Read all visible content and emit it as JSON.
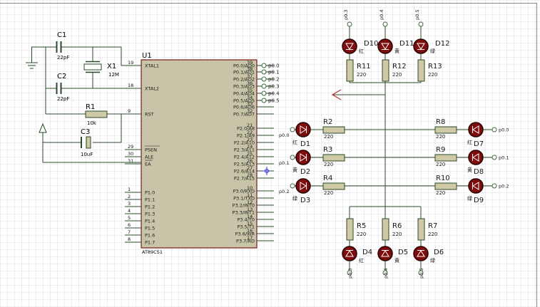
{
  "colors": {
    "background": "#ffffff",
    "grid": "#dedede",
    "wire": "#2a4b2a",
    "chip_fill": "#c7c4a7",
    "chip_border": "#7a1b1b",
    "resistor_fill": "#cfc9a6",
    "led_fill": "#7e0d0d",
    "led_ring": "#2a0000",
    "text": "#1a1a1a",
    "pin_number": "#1a1a1a",
    "ground_marker": "#c23030",
    "crosshair": "#2a36c8",
    "terminal": "#3a6e3a"
  },
  "capacitors": {
    "c1": {
      "name": "C1",
      "value": "22pF"
    },
    "c2": {
      "name": "C2",
      "value": "22pF"
    },
    "c3": {
      "name": "C3",
      "value": "10uF"
    }
  },
  "crystal": {
    "name": "X1",
    "value": "12M"
  },
  "r1": {
    "name": "R1",
    "value": "10k"
  },
  "mcu": {
    "ref": "U1",
    "part": "AT89C51",
    "left_pins": [
      {
        "num": "19",
        "label": "XTAL1"
      },
      {
        "num": "18",
        "label": "XTAL2"
      },
      {
        "num": "9",
        "label": "RST"
      },
      {
        "num": "29",
        "label": "PSEN"
      },
      {
        "num": "30",
        "label": "ALE"
      },
      {
        "num": "31",
        "label": "EA"
      },
      {
        "num": "1",
        "label": "P1.0"
      },
      {
        "num": "2",
        "label": "P1.1"
      },
      {
        "num": "3",
        "label": "P1.2"
      },
      {
        "num": "4",
        "label": "P1.3"
      },
      {
        "num": "5",
        "label": "P1.4"
      },
      {
        "num": "6",
        "label": "P1.5"
      },
      {
        "num": "7",
        "label": "P1.6"
      },
      {
        "num": "8",
        "label": "P1.7"
      }
    ],
    "right_pins": [
      {
        "num": "39",
        "label": "P0.0/AD0"
      },
      {
        "num": "38",
        "label": "P0.1/AD1"
      },
      {
        "num": "37",
        "label": "P0.2/AD2"
      },
      {
        "num": "36",
        "label": "P0.3/AD3"
      },
      {
        "num": "35",
        "label": "P0.4/AD4"
      },
      {
        "num": "34",
        "label": "P0.5/AD5"
      },
      {
        "num": "33",
        "label": "P0.6/AD6"
      },
      {
        "num": "32",
        "label": "P0.7/AD7"
      },
      {
        "num": "21",
        "label": "P2.0/A8"
      },
      {
        "num": "22",
        "label": "P2.1/A9"
      },
      {
        "num": "23",
        "label": "P2.2/A10"
      },
      {
        "num": "24",
        "label": "P2.3/A11"
      },
      {
        "num": "25",
        "label": "P2.4/A12"
      },
      {
        "num": "26",
        "label": "P2.5/A13"
      },
      {
        "num": "27",
        "label": "P2.6/A14"
      },
      {
        "num": "28",
        "label": "P2.7/A15"
      },
      {
        "num": "10",
        "label": "P3.0/RXD"
      },
      {
        "num": "11",
        "label": "P3.1/TXD"
      },
      {
        "num": "12",
        "label": "P3.2/INT0"
      },
      {
        "num": "13",
        "label": "P3.3/INT1"
      },
      {
        "num": "14",
        "label": "P3.4/T0"
      },
      {
        "num": "15",
        "label": "P3.5/T1"
      },
      {
        "num": "16",
        "label": "P3.6/WR"
      },
      {
        "num": "17",
        "label": "P3.7/RD"
      }
    ]
  },
  "port_terminals": [
    "p0.0",
    "p0.1",
    "p0.2",
    "p0.3",
    "p0.4",
    "p0.5"
  ],
  "top_leds": [
    {
      "name": "D10",
      "color_label": "红",
      "port": "p0.3",
      "res": "R11",
      "res_value": "220"
    },
    {
      "name": "D11",
      "color_label": "黄",
      "port": "p0.4",
      "res": "R12",
      "res_value": "220"
    },
    {
      "name": "D12",
      "color_label": "绿",
      "port": "p0.5",
      "res": "R13",
      "res_value": "220"
    }
  ],
  "bottom_leds": [
    {
      "name": "D4",
      "color_label": "红",
      "port": "p0.3",
      "res": "R5",
      "res_value": "220"
    },
    {
      "name": "D5",
      "color_label": "黄",
      "port": "p0.4",
      "res": "R6",
      "res_value": "220"
    },
    {
      "name": "D6",
      "color_label": "绿",
      "port": "p0.5",
      "res": "R7",
      "res_value": "220"
    }
  ],
  "left_leds": [
    {
      "name": "D1",
      "color_label": "红",
      "port": "p0.0",
      "res": "R2",
      "res_value": "220"
    },
    {
      "name": "D2",
      "color_label": "黄",
      "port": "p0.1",
      "res": "R3",
      "res_value": "220"
    },
    {
      "name": "D3",
      "color_label": "绿",
      "port": "p0.2",
      "res": "R4",
      "res_value": "220"
    }
  ],
  "right_leds": [
    {
      "name": "D7",
      "color_label": "红",
      "port": "p0.0",
      "res": "R8",
      "res_value": "220"
    },
    {
      "name": "D8",
      "color_label": "黄",
      "port": "p0.1",
      "res": "R9",
      "res_value": "220"
    },
    {
      "name": "D9",
      "color_label": "绿",
      "port": "p0.2",
      "res": "R10",
      "res_value": "220"
    }
  ]
}
